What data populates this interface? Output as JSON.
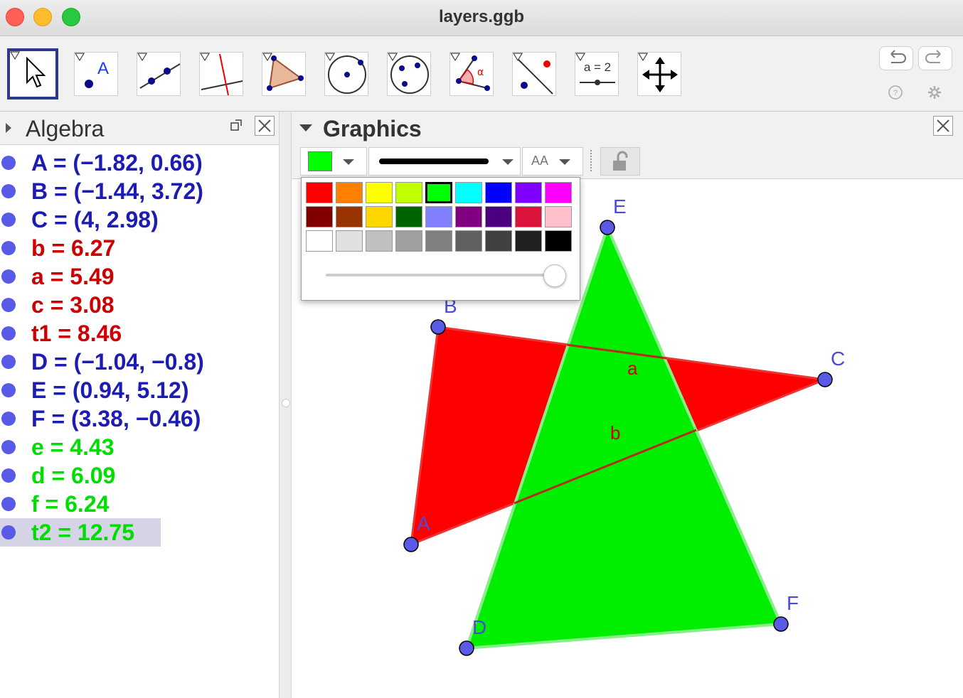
{
  "window": {
    "title": "layers.ggb"
  },
  "toolbar": {
    "tools": [
      "move",
      "point",
      "line",
      "perpendicular-line",
      "polygon",
      "circle-center-point",
      "circle-three-points",
      "angle",
      "reflect-about-line",
      "slider",
      "move-graphics-view"
    ],
    "slider_tool_label": "a = 2",
    "angle_symbol": "α"
  },
  "algebra": {
    "title": "Algebra",
    "items": [
      {
        "text": "A = (−1.82, 0.66)",
        "color": "#1c1cb4"
      },
      {
        "text": "B = (−1.44, 3.72)",
        "color": "#1c1cb4"
      },
      {
        "text": "C = (4, 2.98)",
        "color": "#1c1cb4"
      },
      {
        "text": "b = 6.27",
        "color": "#cc0000"
      },
      {
        "text": "a = 5.49",
        "color": "#cc0000"
      },
      {
        "text": "c = 3.08",
        "color": "#cc0000"
      },
      {
        "text": "t1 = 8.46",
        "color": "#cc0000"
      },
      {
        "text": "D = (−1.04, −0.8)",
        "color": "#1c1cb4"
      },
      {
        "text": "E = (0.94, 5.12)",
        "color": "#1c1cb4"
      },
      {
        "text": "F = (3.38, −0.46)",
        "color": "#1c1cb4"
      },
      {
        "text": "e = 4.43",
        "color": "#00dd00"
      },
      {
        "text": "d = 6.09",
        "color": "#00dd00"
      },
      {
        "text": "f = 6.24",
        "color": "#00dd00"
      },
      {
        "text": "t2 = 12.75",
        "color": "#00dd00"
      }
    ]
  },
  "graphics": {
    "title": "Graphics",
    "stylebar": {
      "color": "#00ff00",
      "text_style_label": "AA"
    },
    "palette": [
      [
        "#ff0000",
        "#ff7f00",
        "#ffff00",
        "#bfff00",
        "#00ff00",
        "#00ffff",
        "#0000ff",
        "#7f00ff",
        "#ff00ff"
      ],
      [
        "#800000",
        "#993300",
        "#ffd700",
        "#006400",
        "#8080ff",
        "#800080",
        "#4b0082",
        "#dc143c",
        "#ffc0cb"
      ],
      [
        "#ffffff",
        "#e0e0e0",
        "#c0c0c0",
        "#a0a0a0",
        "#808080",
        "#606060",
        "#404040",
        "#202020",
        "#000000"
      ]
    ],
    "selected_color": "#00ff00",
    "opacity": 1.0,
    "point_labels": [
      "A",
      "B",
      "C",
      "D",
      "E",
      "F"
    ],
    "segment_labels": [
      "a",
      "b"
    ],
    "colors": {
      "point": "#5a5ae8",
      "label": "#4b4bd8",
      "segment_label": "#cc0000",
      "red_fill": "#ff0000",
      "green_fill": "#00ee00"
    }
  }
}
